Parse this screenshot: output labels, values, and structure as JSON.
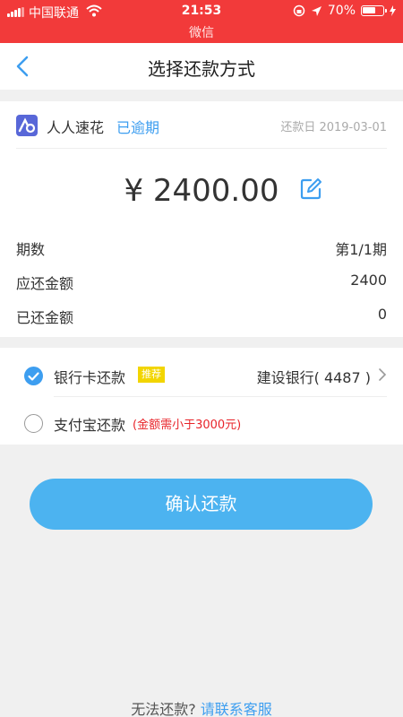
{
  "status_bar": {
    "carrier": "中国联通",
    "time": "21:53",
    "battery": "70%",
    "battery_level": 0.7,
    "app_return": "微信"
  },
  "nav": {
    "title": "选择还款方式",
    "back_icon": "chevron-left-icon"
  },
  "platform": {
    "name": "人人速花",
    "status": "已逾期",
    "due_date": "还款日 2019-03-01"
  },
  "amount": "¥ 2400.00",
  "details": [
    {
      "label": "期数",
      "value": "第1/1期"
    },
    {
      "label": "应还金额",
      "value": "2400"
    },
    {
      "label": "已还金额",
      "value": "0"
    }
  ],
  "payment_options": {
    "bank": {
      "label": "银行卡还款",
      "badge": "推荐",
      "account": "建设银行( 4487 )"
    },
    "alipay": {
      "label": "支付宝还款",
      "note": "(金额需小于3000元)"
    }
  },
  "confirm_label": "确认还款",
  "footer": {
    "prompt": "无法还款?",
    "link": "请联系客服"
  },
  "colors": {
    "status_bar": "#f23a3a",
    "accent": "#3d9ef0",
    "button": "#4cb3f0",
    "badge": "#f2d500",
    "warning": "#e8242a"
  }
}
